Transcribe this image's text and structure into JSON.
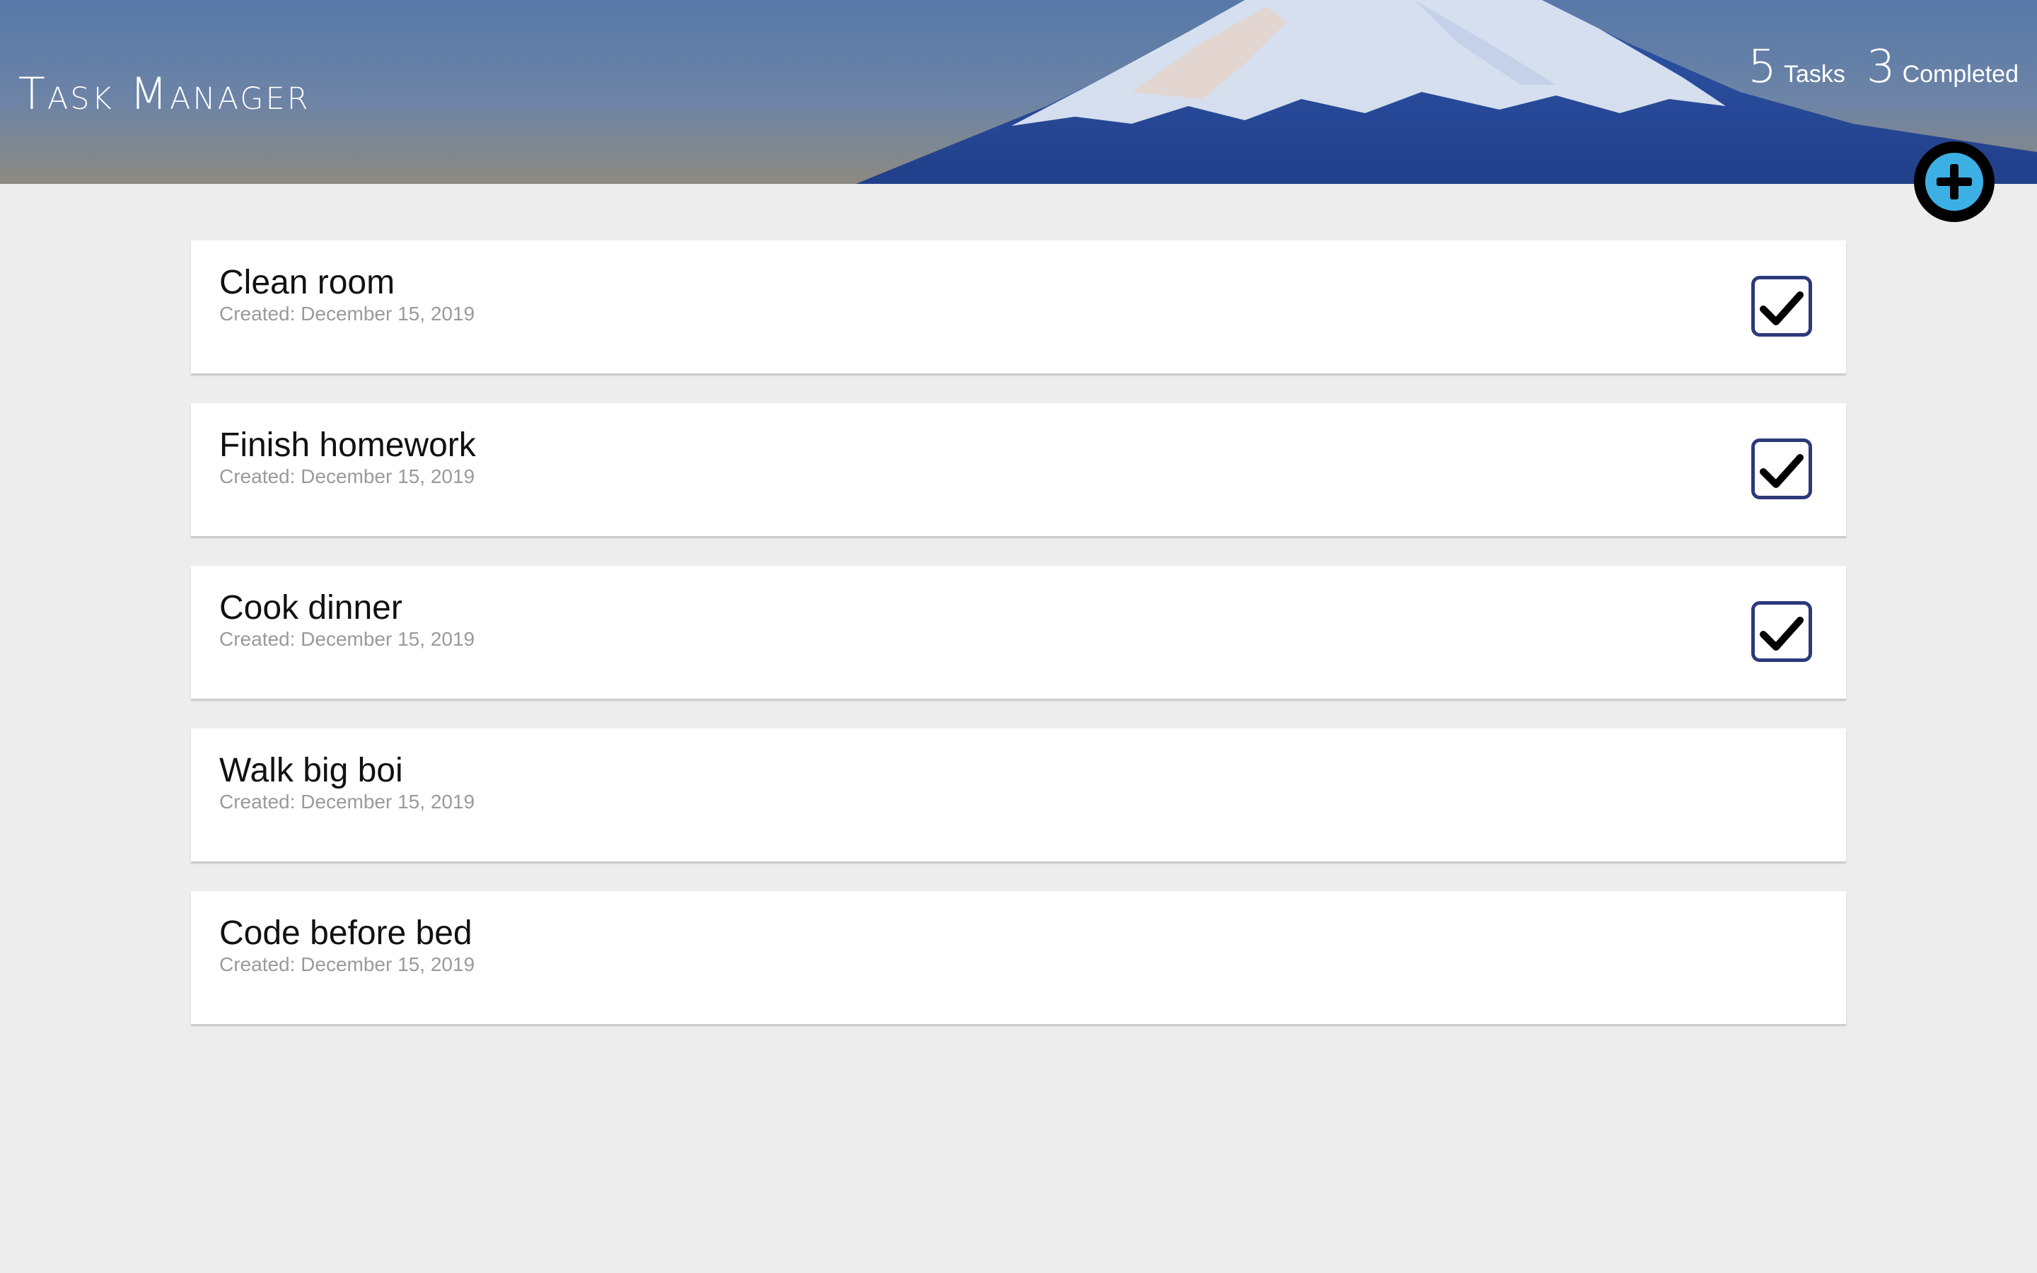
{
  "header": {
    "title": "Task Manager",
    "stats": {
      "tasks_count": "5",
      "tasks_label": "Tasks",
      "completed_count": "3",
      "completed_label": "Completed"
    }
  },
  "add_button": {
    "icon": "plus-circle-icon"
  },
  "colors": {
    "page_background": "#ededed",
    "card_background": "#ffffff",
    "accent": "#3cb0e4",
    "checkbox_border": "#2c3a7a"
  },
  "tasks": [
    {
      "title": "Clean room",
      "created": "Created: December 15, 2019",
      "completed": true
    },
    {
      "title": "Finish homework",
      "created": "Created: December 15, 2019",
      "completed": true
    },
    {
      "title": "Cook dinner",
      "created": "Created: December 15, 2019",
      "completed": true
    },
    {
      "title": "Walk big boi",
      "created": "Created: December 15, 2019",
      "completed": false
    },
    {
      "title": "Code before bed",
      "created": "Created: December 15, 2019",
      "completed": false
    }
  ]
}
